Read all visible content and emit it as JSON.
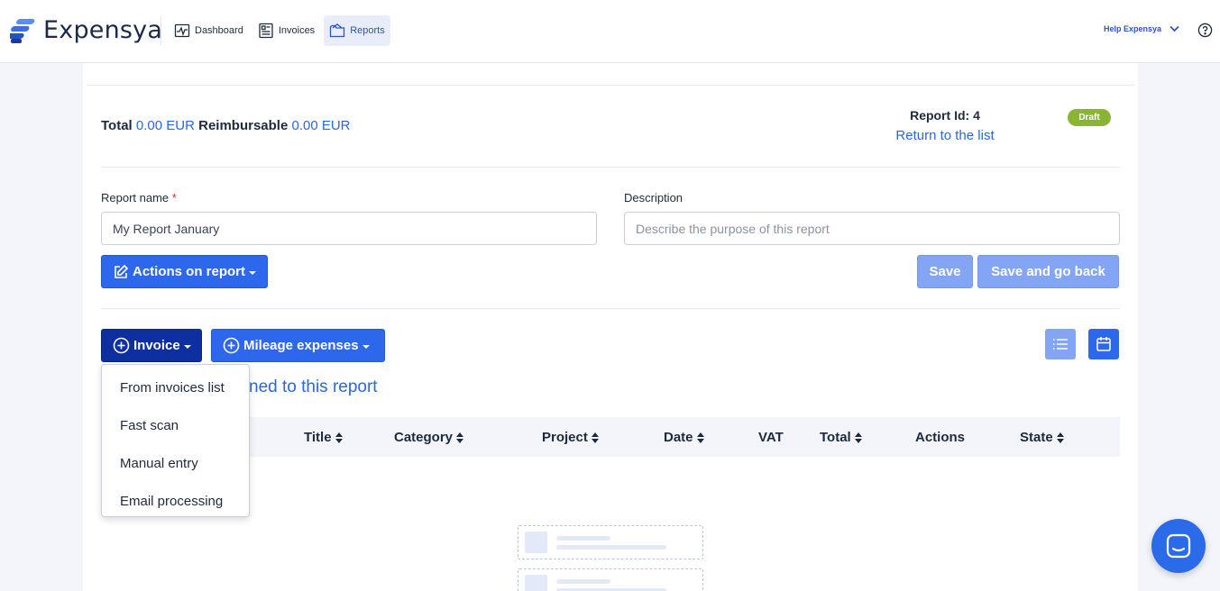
{
  "brand": {
    "name": "Expensya"
  },
  "nav": [
    {
      "label": "Dashboard",
      "icon": "activity-icon"
    },
    {
      "label": "Invoices",
      "icon": "receipt-icon"
    },
    {
      "label": "Reports",
      "icon": "folder-icon",
      "active": true
    }
  ],
  "help": {
    "label": "Help Expensya"
  },
  "summary": {
    "total_label": "Total",
    "total_value": "0.00 EUR",
    "reimbursable_label": "Reimbursable",
    "reimbursable_value": "0.00 EUR"
  },
  "report": {
    "id_text": "Report Id: 4",
    "return_link": "Return to the list",
    "status": "Draft",
    "status_color": "#8ab435"
  },
  "form": {
    "name_label": "Report name",
    "name_required": "*",
    "name_value": "My Report January",
    "description_label": "Description",
    "description_placeholder": "Describe the purpose of this report"
  },
  "buttons": {
    "actions": "Actions on report",
    "save": "Save",
    "save_back": "Save and go back",
    "invoice": "Invoice",
    "mileage": "Mileage expenses"
  },
  "section": {
    "title_visible": "ned to this report"
  },
  "table": {
    "columns": [
      "Title",
      "Category",
      "Project",
      "Date",
      "VAT",
      "Total",
      "Actions",
      "State"
    ]
  },
  "invoice_menu": [
    "From invoices list",
    "Fast scan",
    "Manual entry",
    "Email processing"
  ],
  "colors": {
    "primary": "#2d67ec",
    "dark": "#0d2fa0",
    "link": "#2b66e3"
  }
}
